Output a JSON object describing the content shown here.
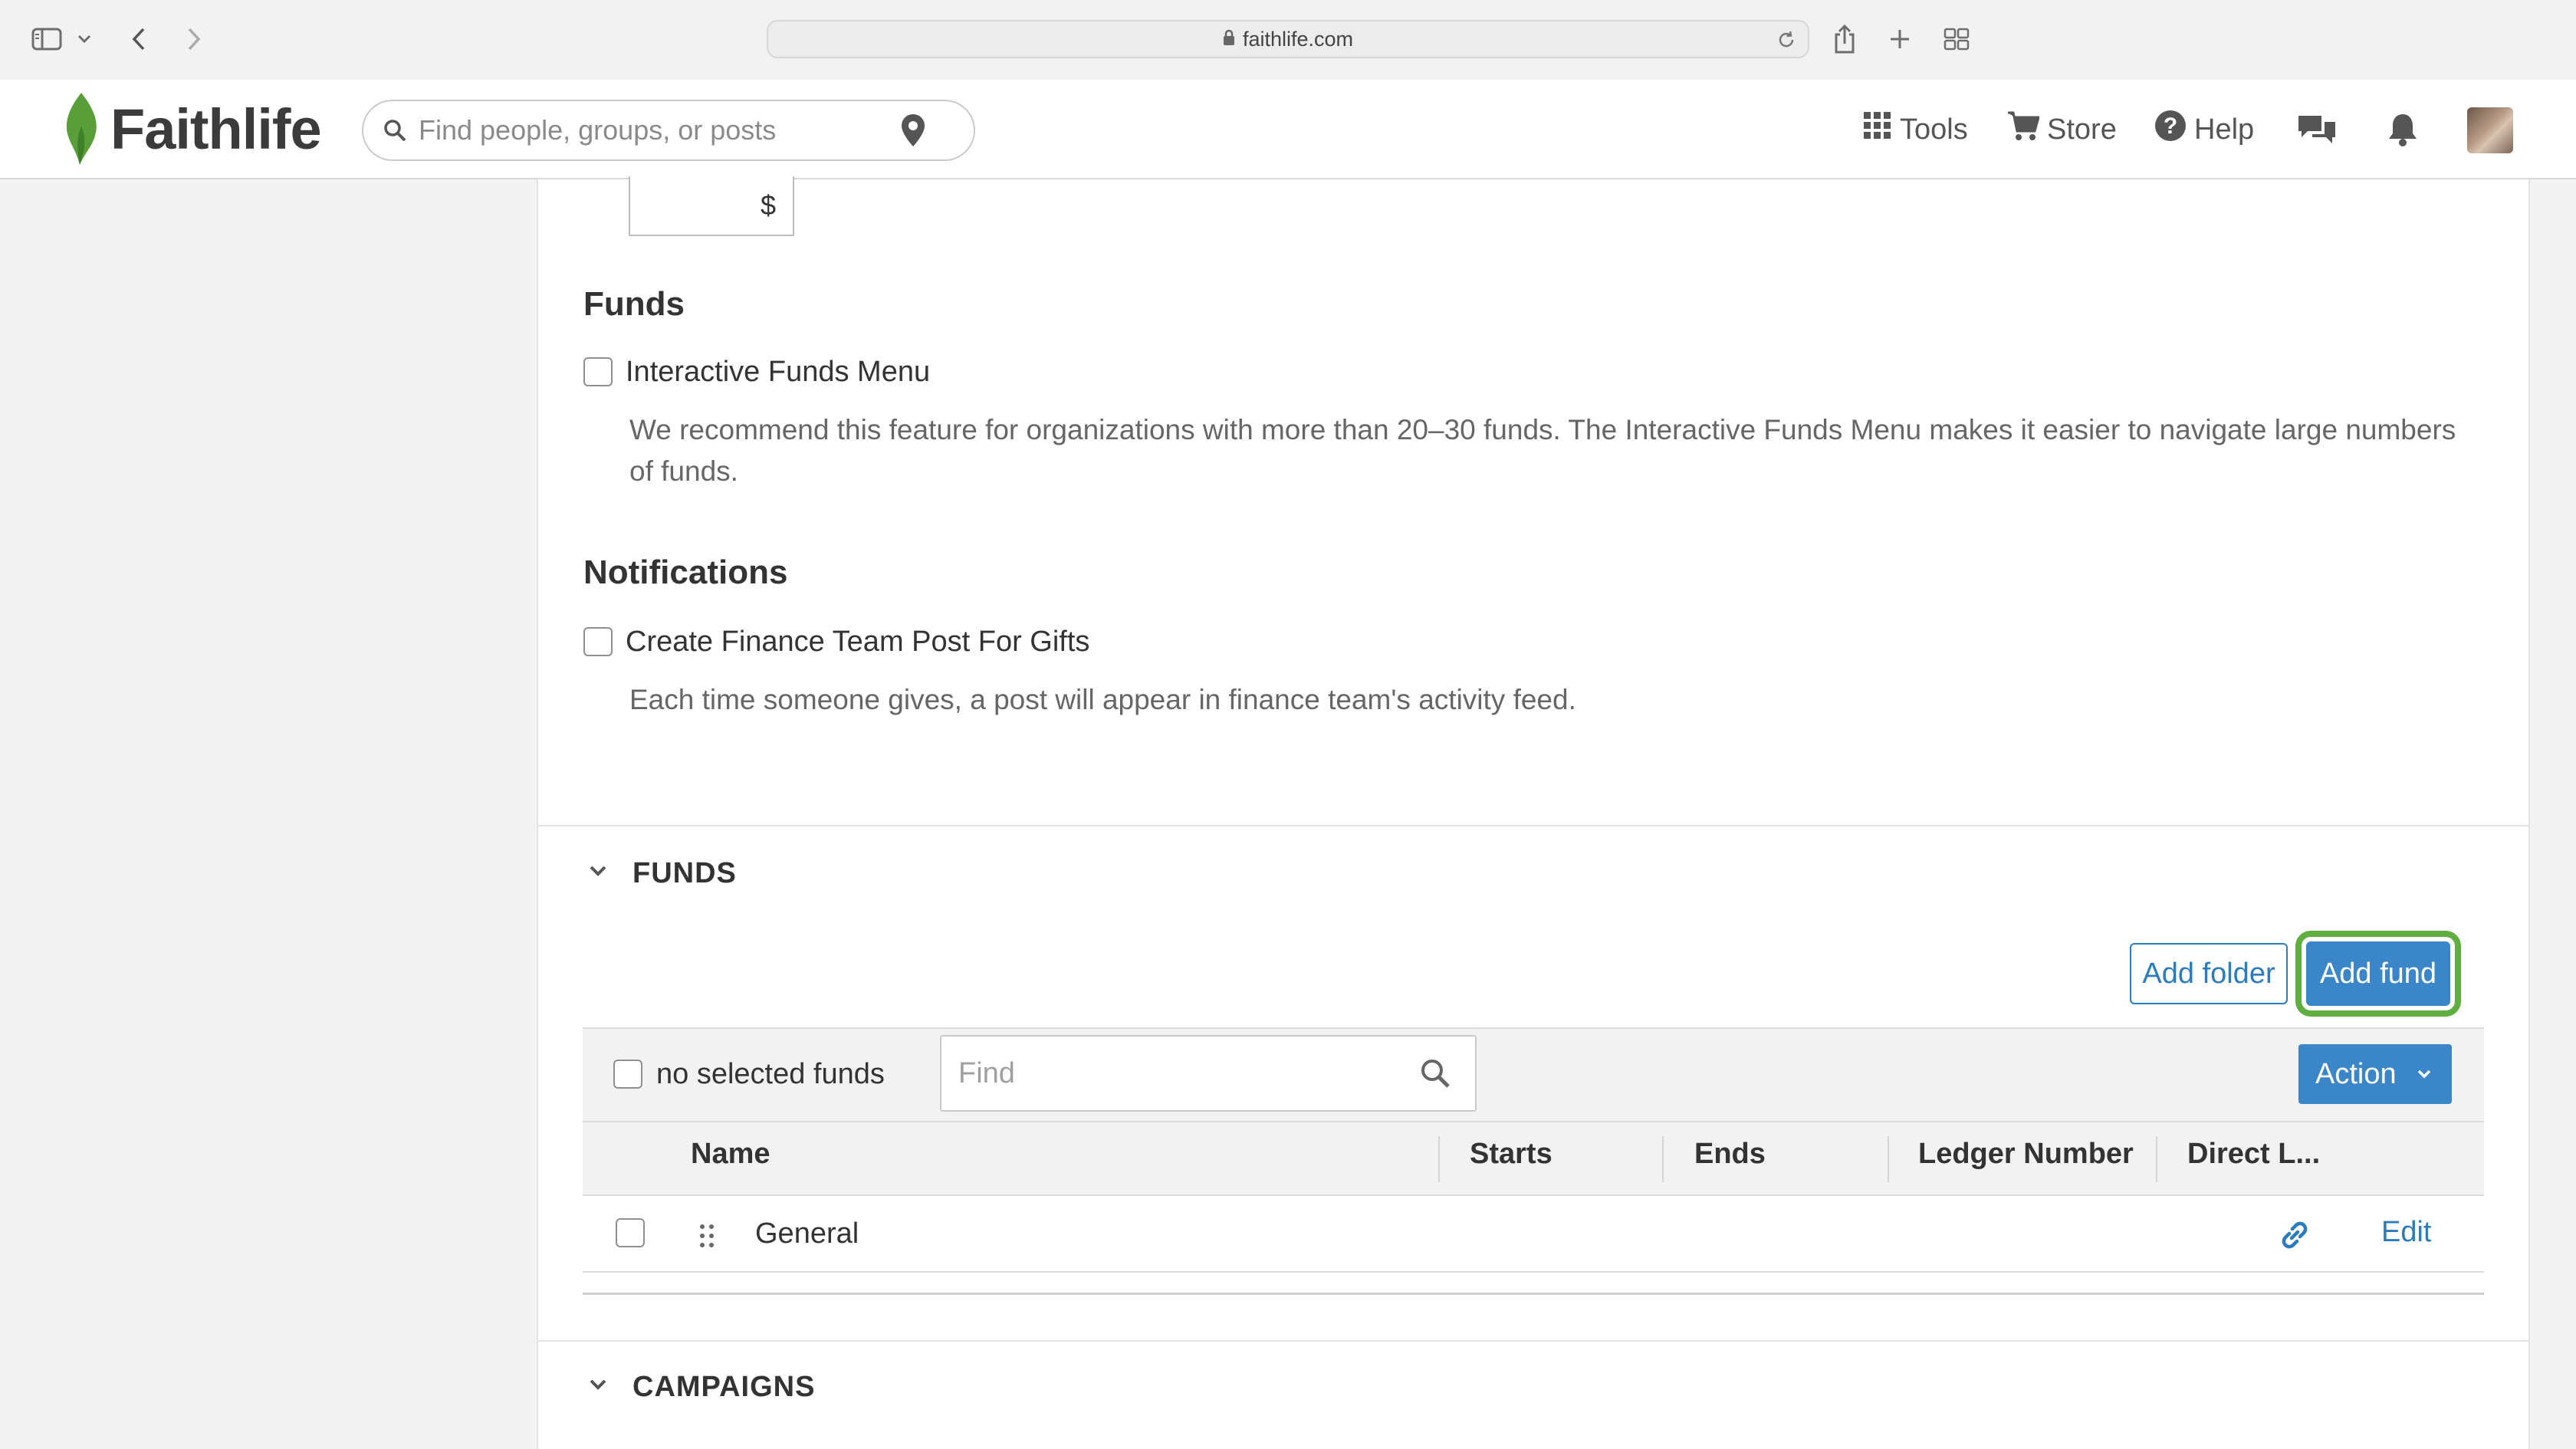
{
  "browser": {
    "url": "faithlife.com"
  },
  "header": {
    "logo_text": "Faithlife",
    "search_placeholder": "Find people, groups, or posts",
    "nav": [
      {
        "label": "Tools"
      },
      {
        "label": "Store"
      },
      {
        "label": "Help"
      }
    ]
  },
  "settings": {
    "amount_symbol": "$",
    "funds_heading": "Funds",
    "interactive_menu_label": "Interactive Funds Menu",
    "interactive_menu_desc_line1": "We recommend this feature for organizations with more than 20–30 funds. The Interactive Funds Menu makes it easier to navigate large numbers",
    "interactive_menu_desc_line2": "of funds.",
    "notifications_heading": "Notifications",
    "finance_post_label": "Create Finance Team Post For Gifts",
    "finance_post_desc": "Each time someone gives, a post will appear in finance team's activity feed."
  },
  "funds_section": {
    "title": "FUNDS",
    "add_folder_label": "Add folder",
    "add_fund_label": "Add fund",
    "selection_label": "no selected funds",
    "find_placeholder": "Find",
    "action_label": "Action",
    "columns": [
      "Name",
      "Starts",
      "Ends",
      "Ledger Number",
      "Direct L..."
    ],
    "rows": [
      {
        "name": "General",
        "starts": "",
        "ends": "",
        "ledger": "",
        "edit_label": "Edit"
      }
    ]
  },
  "campaigns_section": {
    "title": "CAMPAIGNS"
  },
  "colors": {
    "accent": "#3a86c8",
    "highlight_ring": "#5fae3f",
    "logo_green": "#5a9e3a"
  }
}
